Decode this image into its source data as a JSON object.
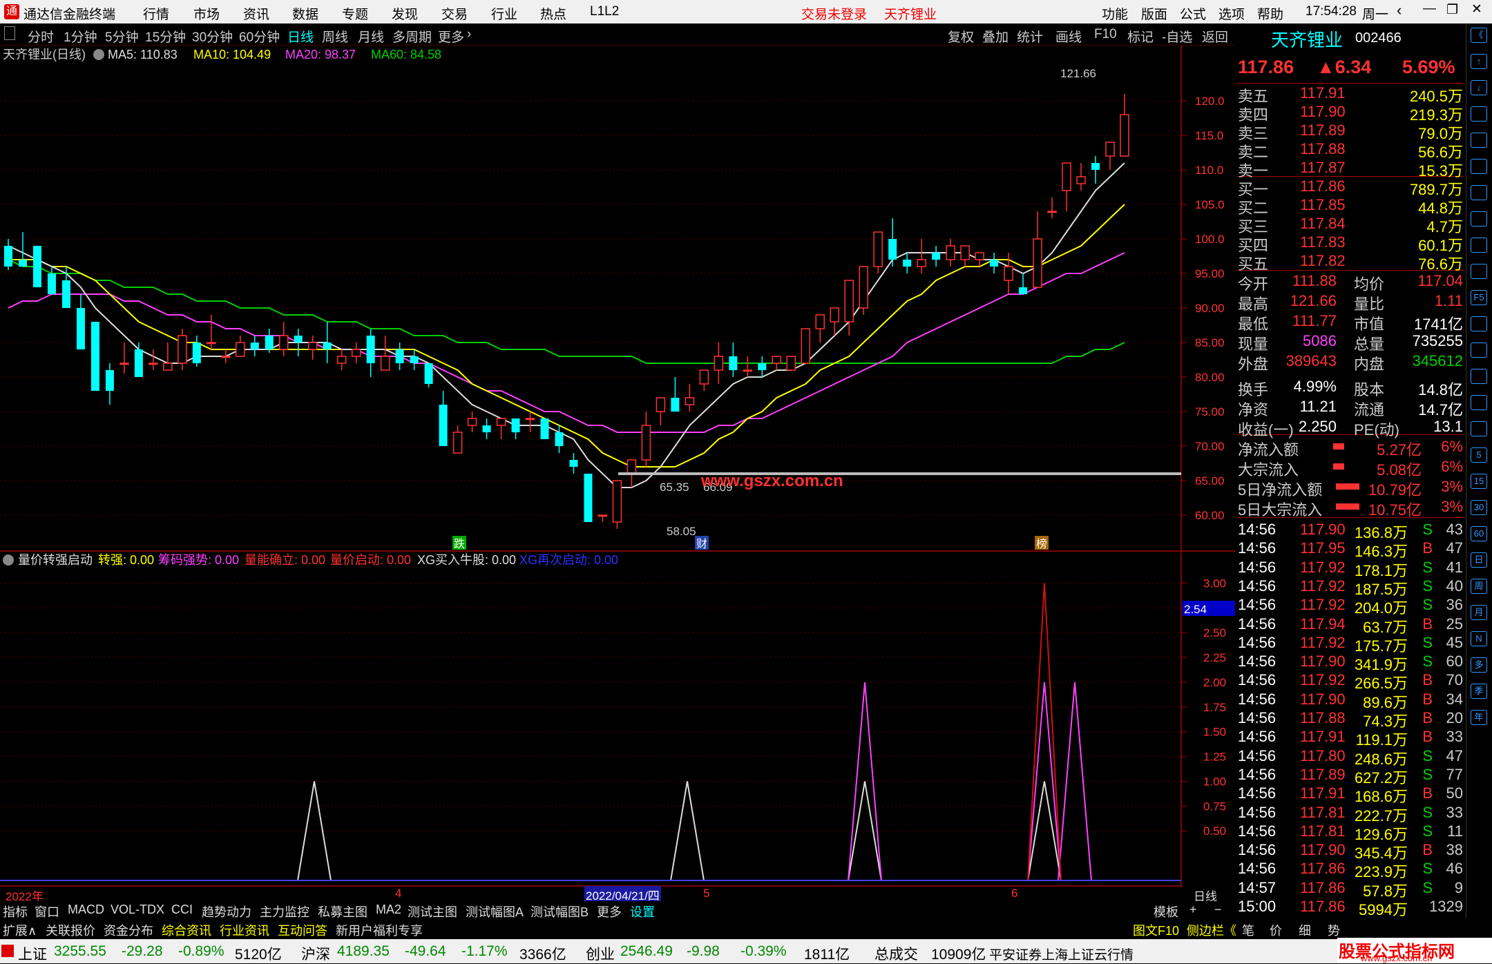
{
  "app": {
    "title": "通达信金融终端",
    "menu": [
      "行情",
      "市场",
      "资讯",
      "数据",
      "专题",
      "发现",
      "交易",
      "行业",
      "热点",
      "L1L2"
    ],
    "login_status": "交易未登录",
    "stock_name_title": "天齐锂业",
    "right_menu": [
      "功能",
      "版面",
      "公式",
      "选项",
      "帮助"
    ],
    "clock": "17:54:28",
    "weekday": "周一"
  },
  "periods": [
    "分时",
    "1分钟",
    "5分钟",
    "15分钟",
    "30分钟",
    "60分钟",
    "日线",
    "周线",
    "月线",
    "多周期",
    "更多"
  ],
  "active_period": "日线",
  "toolbar_right": [
    "复权",
    "叠加",
    "统计",
    "画线",
    "F10",
    "标记",
    "-自选",
    "返回"
  ],
  "main": {
    "legend_name": "天齐锂业(日线)",
    "ma5": "MA5: 110.83",
    "ma10": "MA10: 104.49",
    "ma20": "MA20: 98.37",
    "ma60": "MA60: 84.58",
    "high_label": "121.66",
    "low_label": "58.05",
    "label_6535": "65.35",
    "label_6609": "66.09",
    "watermark": "www.gszx.com.cn",
    "tag_die": "跌",
    "tag_cai": "财",
    "tag_bang": "榜"
  },
  "sub": {
    "title": "量价转强启动",
    "items": [
      {
        "label": "转强: 0.00",
        "color": "#ffff00"
      },
      {
        "label": "筹码强势: 0.00",
        "color": "#ff40ff"
      },
      {
        "label": "量能确立: 0.00",
        "color": "#ff3232"
      },
      {
        "label": "量价启动: 0.00",
        "color": "#ff3232"
      },
      {
        "label": "XG买入牛股: 0.00",
        "color": "#dddddd"
      },
      {
        "label": "XG再次启动: 0.00",
        "color": "#3030ff"
      }
    ],
    "current_value": "2.54"
  },
  "axis": {
    "date_left": "2022年",
    "date_mid": "2022/04/21/四",
    "month4": "4",
    "month5": "5",
    "month6": "6",
    "period_label": "日线"
  },
  "chart_data": {
    "type": "candlestick",
    "y_ticks": [
      120,
      115,
      110,
      105,
      100,
      95,
      90,
      85,
      80,
      75,
      70,
      65,
      60
    ],
    "y_tick_labels": [
      "120.0",
      "115.0",
      "110.0",
      "105.0",
      "100.0",
      "95.00",
      "90.00",
      "85.00",
      "80.00",
      "75.00",
      "70.00",
      "65.00",
      "60.00"
    ],
    "sub_y_ticks": [
      3,
      2.75,
      2.5,
      2.25,
      2,
      1.75,
      1.5,
      1.25,
      1,
      0.75,
      0.5
    ],
    "sub_y_tick_labels": [
      "3.00",
      "2.75",
      "2.50",
      "2.25",
      "2.00",
      "1.75",
      "1.50",
      "1.25",
      "1.00",
      "0.75",
      "0.50"
    ],
    "y_range": [
      56,
      126
    ],
    "sub_y_range": [
      0,
      3.1
    ],
    "candles": [
      [
        99,
        100,
        96,
        95.5
      ],
      [
        97,
        101,
        96,
        96
      ],
      [
        99,
        99,
        93,
        93
      ],
      [
        95,
        96,
        92,
        92
      ],
      [
        94,
        96,
        90,
        90.5
      ],
      [
        90,
        92,
        84,
        84
      ],
      [
        88,
        88,
        78,
        78
      ],
      [
        81,
        82,
        78,
        76
      ],
      [
        82,
        85,
        82,
        80.5
      ],
      [
        84,
        85,
        80,
        80
      ],
      [
        82,
        84,
        82,
        81
      ],
      [
        81,
        85,
        82,
        81
      ],
      [
        82,
        87,
        86,
        81
      ],
      [
        85,
        86,
        82,
        81.5
      ],
      [
        85,
        89,
        85,
        84
      ],
      [
        83,
        84,
        83,
        82
      ],
      [
        83,
        86,
        85,
        83
      ],
      [
        85,
        86,
        84,
        83
      ],
      [
        86,
        87,
        84,
        83.5
      ],
      [
        84,
        88,
        86,
        83
      ],
      [
        86,
        87,
        85,
        83
      ],
      [
        84,
        86,
        85,
        82.5
      ],
      [
        85,
        88,
        84,
        82
      ],
      [
        82,
        84,
        83,
        81
      ],
      [
        83,
        85,
        84,
        82
      ],
      [
        86,
        87,
        82,
        80
      ],
      [
        81,
        86,
        83,
        81
      ],
      [
        84,
        85,
        82,
        81
      ],
      [
        83,
        84,
        82,
        81
      ],
      [
        82,
        82,
        79,
        78.5
      ],
      [
        76,
        78,
        70,
        70
      ],
      [
        69,
        73,
        72,
        69
      ],
      [
        73,
        75,
        74,
        72
      ],
      [
        73,
        74,
        72,
        71
      ],
      [
        73,
        74,
        74,
        71
      ],
      [
        74,
        74,
        72,
        71
      ],
      [
        74,
        75,
        74,
        72
      ],
      [
        74,
        74,
        71,
        71
      ],
      [
        72,
        73,
        70,
        69
      ],
      [
        68,
        69,
        67,
        66
      ],
      [
        66,
        64,
        59,
        59
      ],
      [
        60,
        60,
        60,
        59
      ],
      [
        59,
        65,
        65,
        58
      ],
      [
        66,
        67,
        68,
        64
      ],
      [
        68,
        75,
        73,
        67
      ],
      [
        75,
        77,
        77,
        73
      ],
      [
        77,
        80,
        75,
        75
      ],
      [
        76,
        79,
        77,
        75
      ],
      [
        79,
        81,
        81,
        78
      ],
      [
        81,
        85,
        83,
        79
      ],
      [
        83,
        85,
        81,
        80
      ],
      [
        81,
        83,
        81,
        80
      ],
      [
        82,
        83,
        81,
        80
      ],
      [
        82,
        83,
        83,
        81
      ],
      [
        81,
        83,
        83,
        82
      ],
      [
        82,
        86,
        87,
        82
      ],
      [
        87,
        88,
        89,
        85
      ],
      [
        88,
        90,
        90,
        86
      ],
      [
        88,
        92,
        94,
        86
      ],
      [
        90,
        94,
        96,
        89
      ],
      [
        96,
        101,
        101,
        95
      ],
      [
        100,
        103,
        97,
        96
      ],
      [
        97,
        98,
        96,
        95
      ],
      [
        96,
        100,
        97,
        95
      ],
      [
        98,
        99,
        97,
        96
      ],
      [
        97,
        100,
        99,
        96
      ],
      [
        97,
        99,
        99,
        96
      ],
      [
        97,
        98,
        98,
        96
      ],
      [
        97,
        98,
        96,
        95
      ],
      [
        94,
        98,
        96,
        92
      ],
      [
        93,
        95,
        92,
        92
      ],
      [
        93,
        104,
        100,
        93
      ],
      [
        104,
        106,
        104,
        103
      ],
      [
        107,
        110,
        111,
        104
      ],
      [
        108,
        111,
        109,
        107
      ],
      [
        111,
        112,
        110,
        108
      ],
      [
        112,
        114,
        114,
        110
      ],
      [
        112,
        121,
        118,
        112
      ]
    ],
    "ma5": [
      99,
      98,
      97,
      96,
      95,
      93,
      90,
      88,
      86,
      84,
      83,
      82,
      82,
      83,
      83,
      83,
      84,
      84,
      84,
      85,
      85,
      85,
      85,
      84,
      84,
      84,
      84,
      83,
      83,
      82,
      80,
      78,
      76,
      75,
      74,
      73,
      73,
      73,
      72,
      71,
      68,
      66,
      64,
      64,
      65,
      67,
      70,
      73,
      75,
      77,
      79,
      80,
      80,
      81,
      81,
      82,
      84,
      86,
      88,
      91,
      94,
      97,
      98,
      98,
      98,
      98,
      98,
      97,
      97,
      96,
      95,
      96,
      98,
      101,
      104,
      107,
      109,
      111
    ],
    "ma10": [
      97,
      97,
      97,
      96,
      96,
      95,
      94,
      92,
      90,
      88,
      87,
      86,
      85,
      85,
      84,
      84,
      84,
      84,
      84,
      84,
      84,
      84,
      84,
      84,
      84,
      84,
      84,
      84,
      84,
      83,
      82,
      81,
      79,
      78,
      77,
      76,
      75,
      74,
      73,
      72,
      71,
      69,
      68,
      67,
      67,
      67,
      67,
      68,
      69,
      71,
      72,
      74,
      75,
      77,
      78,
      79,
      81,
      82,
      83,
      85,
      87,
      89,
      91,
      92,
      94,
      95,
      96,
      96,
      97,
      97,
      96,
      96,
      97,
      98,
      99,
      101,
      103,
      105
    ],
    "ma20": [
      90,
      91,
      91,
      92,
      92,
      92,
      92,
      92,
      91,
      91,
      90,
      89,
      89,
      88,
      88,
      87,
      87,
      86,
      86,
      86,
      85,
      85,
      84,
      84,
      84,
      83,
      83,
      83,
      82,
      82,
      81,
      80,
      79,
      78,
      78,
      77,
      76,
      75,
      75,
      74,
      73,
      73,
      72,
      72,
      72,
      72,
      72,
      72,
      72,
      73,
      73,
      74,
      74,
      75,
      76,
      77,
      78,
      79,
      80,
      81,
      82,
      83,
      85,
      86,
      87,
      88,
      89,
      90,
      91,
      92,
      92,
      93,
      94,
      95,
      95,
      96,
      97,
      98
    ],
    "ma60": [
      97,
      96,
      96,
      95,
      95,
      95,
      94,
      94,
      93,
      93,
      93,
      92,
      92,
      91,
      91,
      91,
      90,
      90,
      90,
      89,
      89,
      89,
      88,
      88,
      88,
      87,
      87,
      87,
      86,
      86,
      86,
      85,
      85,
      85,
      84,
      84,
      84,
      84,
      83,
      83,
      83,
      83,
      83,
      83,
      82,
      82,
      82,
      82,
      82,
      82,
      82,
      82,
      82,
      82,
      82,
      82,
      82,
      82,
      82,
      82,
      82,
      82,
      82,
      82,
      82,
      82,
      82,
      82,
      82,
      82,
      82,
      82,
      82,
      83,
      83,
      84,
      84,
      85
    ],
    "sub_white_peaks": [
      15,
      33,
      42,
      50
    ],
    "sub_magenta_peaks": [
      [
        42,
        2
      ],
      [
        50,
        2.0
      ],
      [
        52,
        2.0
      ]
    ],
    "sub_red_peaks": [
      [
        50,
        3
      ]
    ]
  },
  "quote": {
    "name": "天齐锂业",
    "code": "002466",
    "price": "117.86",
    "change": "▲6.34",
    "pct": "5.69%",
    "sells": [
      [
        "卖五",
        "117.91",
        "240.5万"
      ],
      [
        "卖四",
        "117.90",
        "219.3万"
      ],
      [
        "卖三",
        "117.89",
        "79.0万"
      ],
      [
        "卖二",
        "117.88",
        "56.6万"
      ],
      [
        "卖一",
        "117.87",
        "15.3万"
      ]
    ],
    "buys": [
      [
        "买一",
        "117.86",
        "789.7万"
      ],
      [
        "买二",
        "117.85",
        "44.8万"
      ],
      [
        "买三",
        "117.84",
        "4.7万"
      ],
      [
        "买四",
        "117.83",
        "60.1万"
      ],
      [
        "买五",
        "117.82",
        "76.6万"
      ]
    ],
    "stats": [
      [
        "今开",
        "111.88",
        "均价",
        "117.04"
      ],
      [
        "最高",
        "121.66",
        "量比",
        "1.11"
      ],
      [
        "最低",
        "111.77",
        "市值",
        "1741亿"
      ],
      [
        "现量",
        "5086",
        "总量",
        "735255"
      ],
      [
        "外盘",
        "389643",
        "内盘",
        "345612"
      ],
      [
        "换手",
        "4.99%",
        "股本",
        "14.8亿"
      ],
      [
        "净资",
        "11.21",
        "流通",
        "14.7亿"
      ],
      [
        "收益(一)",
        "2.250",
        "PE(动)",
        "13.1"
      ]
    ],
    "flows": [
      [
        "净流入额",
        "5.27亿",
        "6%"
      ],
      [
        "大宗流入",
        "5.08亿",
        "6%"
      ],
      [
        "5日净流入额",
        "10.79亿",
        "3%"
      ],
      [
        "5日大宗流入",
        "10.75亿",
        "3%"
      ]
    ],
    "ticks": [
      [
        "14:56",
        "117.90",
        "136.8万",
        "S",
        "43"
      ],
      [
        "14:56",
        "117.95",
        "146.3万",
        "B",
        "47"
      ],
      [
        "14:56",
        "117.92",
        "178.1万",
        "S",
        "41"
      ],
      [
        "14:56",
        "117.92",
        "187.5万",
        "S",
        "40"
      ],
      [
        "14:56",
        "117.92",
        "204.0万",
        "S",
        "36"
      ],
      [
        "14:56",
        "117.94",
        "63.7万",
        "B",
        "25"
      ],
      [
        "14:56",
        "117.92",
        "175.7万",
        "S",
        "45"
      ],
      [
        "14:56",
        "117.90",
        "341.9万",
        "S",
        "60"
      ],
      [
        "14:56",
        "117.92",
        "266.5万",
        "B",
        "70"
      ],
      [
        "14:56",
        "117.90",
        "89.6万",
        "B",
        "34"
      ],
      [
        "14:56",
        "117.88",
        "74.3万",
        "B",
        "20"
      ],
      [
        "14:56",
        "117.91",
        "119.1万",
        "B",
        "33"
      ],
      [
        "14:56",
        "117.80",
        "248.6万",
        "S",
        "47"
      ],
      [
        "14:56",
        "117.89",
        "627.2万",
        "S",
        "77"
      ],
      [
        "14:56",
        "117.91",
        "168.6万",
        "B",
        "50"
      ],
      [
        "14:56",
        "117.81",
        "222.7万",
        "S",
        "33"
      ],
      [
        "14:56",
        "117.81",
        "129.6万",
        "S",
        "11"
      ],
      [
        "14:56",
        "117.90",
        "345.4万",
        "B",
        "38"
      ],
      [
        "14:56",
        "117.86",
        "223.9万",
        "S",
        "46"
      ],
      [
        "14:57",
        "117.86",
        "57.8万",
        "S",
        "9"
      ],
      [
        "15:00",
        "117.86",
        "5994万",
        "",
        "1329"
      ]
    ]
  },
  "tabs1": [
    "指标",
    "窗口",
    "MACD",
    "VOL-TDX",
    "CCI",
    "趋势动力",
    "主力监控",
    "私募主图",
    "MA2",
    "测试主图",
    "测试幅图A",
    "测试幅图B",
    "更多",
    "设置"
  ],
  "tabs1_right": [
    "模板",
    "+",
    "−"
  ],
  "tabs2": [
    "扩展∧",
    "关联报价",
    "资金分布",
    "综合资讯",
    "行业资讯",
    "互动问答",
    "新用户福利专享"
  ],
  "tabs2_right": [
    "图文F10",
    "侧边栏《",
    "笔",
    "价",
    "细",
    "势"
  ],
  "status": {
    "sh_name": "上证",
    "sh_val": "3255.55",
    "sh_chg": "-29.28",
    "sh_pct": "-0.89%",
    "sh_amt": "5120亿",
    "sz_name": "沪深",
    "sz_val": "4189.35",
    "sz_chg": "-49.64",
    "sz_pct": "-1.17%",
    "sz_amt": "3366亿",
    "cy_name": "创业",
    "cy_val": "2546.49",
    "cy_chg": "-9.98",
    "cy_pct": "-0.39%",
    "cy_amt": "1811亿",
    "total_label": "总成交",
    "total_val": "10909亿",
    "broker": "平安证券上海上证云行情",
    "brand": "股票公式指标网",
    "brand_url": "www.gszx.com.cn"
  },
  "side_icons": [
    "《",
    "↑",
    "↓",
    "cal",
    "list",
    "line",
    "bar",
    "doc",
    "F10",
    "box",
    "F5",
    "chk",
    "RSI",
    "move",
    "pen",
    "grid",
    "5",
    "15",
    "30",
    "60",
    "日",
    "周",
    "月",
    "N",
    "多",
    "季",
    "年"
  ]
}
